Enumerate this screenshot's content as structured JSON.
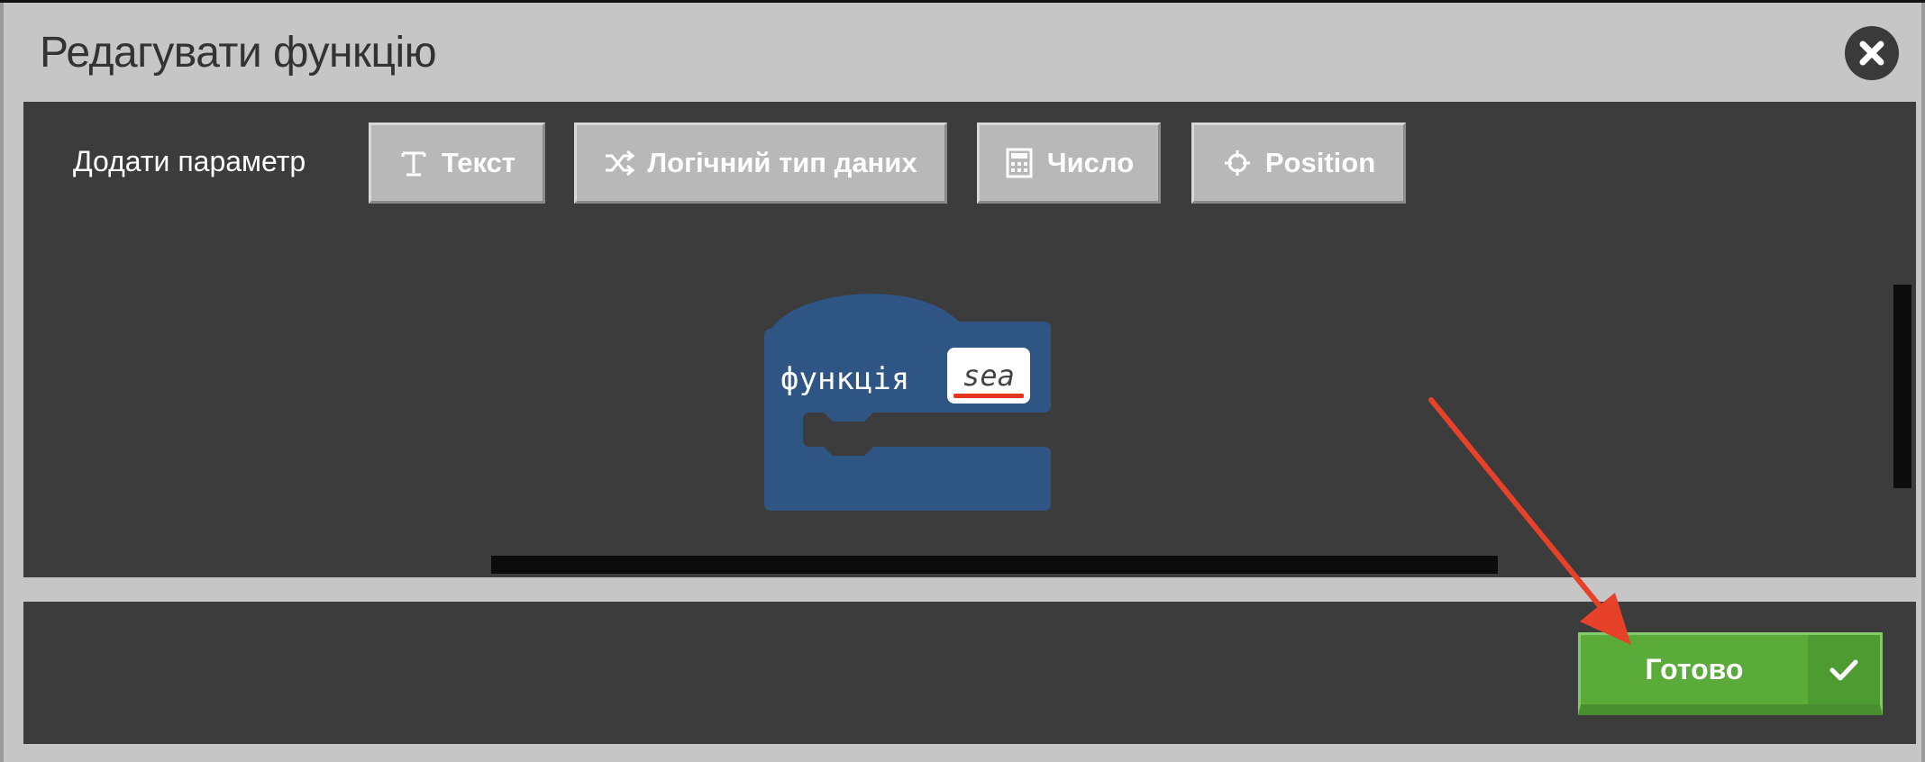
{
  "dialog": {
    "title": "Редагувати функцію",
    "close_icon": "close-icon"
  },
  "toolbar": {
    "add_param_label": "Додати параметр",
    "buttons": [
      {
        "label": "Текст",
        "icon": "text-icon"
      },
      {
        "label": "Логічний тип даних",
        "icon": "shuffle-icon"
      },
      {
        "label": "Число",
        "icon": "calculator-icon"
      },
      {
        "label": "Position",
        "icon": "crosshair-icon"
      }
    ]
  },
  "block": {
    "label": "функція",
    "name": "sea",
    "color": "#2f5585"
  },
  "footer": {
    "done_label": "Готово",
    "done_icon": "check-icon",
    "accent": "#5bab3a"
  },
  "annotation": {
    "arrow_color": "#e8412a"
  }
}
